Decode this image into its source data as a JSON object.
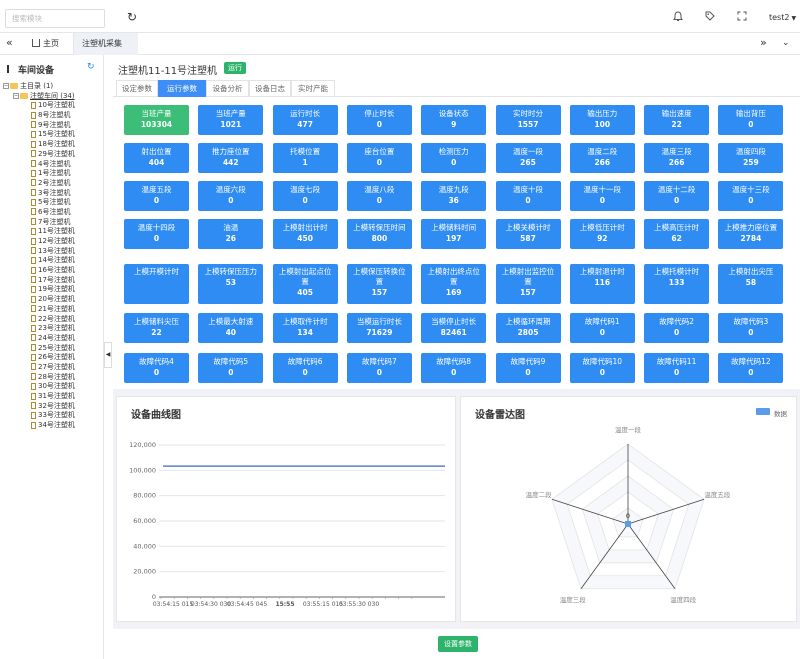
{
  "topbar": {
    "search_placeholder": "搜索模块",
    "user_name": "test2"
  },
  "tabs": {
    "home_label": "主页",
    "active_label": "注塑机采集"
  },
  "left_panel": {
    "title": "车间设备",
    "tree_root": "主目录 (1)",
    "tree_group": "注塑车间 (34)",
    "machines": [
      "10号注塑机",
      "8号注塑机",
      "9号注塑机",
      "15号注塑机",
      "18号注塑机",
      "29号注塑机",
      "4号注塑机",
      "1号注塑机",
      "2号注塑机",
      "3号注塑机",
      "5号注塑机",
      "6号注塑机",
      "7号注塑机",
      "11号注塑机",
      "12号注塑机",
      "13号注塑机",
      "14号注塑机",
      "16号注塑机",
      "17号注塑机",
      "19号注塑机",
      "20号注塑机",
      "21号注塑机",
      "22号注塑机",
      "23号注塑机",
      "24号注塑机",
      "25号注塑机",
      "26号注塑机",
      "27号注塑机",
      "28号注塑机",
      "30号注塑机",
      "31号注塑机",
      "32号注塑机",
      "33号注塑机",
      "34号注塑机"
    ]
  },
  "main": {
    "machine_title": "注塑机11-11号注塑机",
    "status": "运行",
    "subtabs": [
      "设定参数",
      "运行参数",
      "设备分析",
      "设备日志",
      "实时产能"
    ],
    "active_subtab": 1,
    "cards": [
      [
        {
          "label": "当班产量",
          "value": "103304",
          "highlight": true
        },
        {
          "label": "当班产量",
          "value": "1021"
        },
        {
          "label": "运行时长",
          "value": "477"
        },
        {
          "label": "停止时长",
          "value": "0"
        },
        {
          "label": "设备状态",
          "value": "9"
        },
        {
          "label": "实时时分",
          "value": "1557"
        },
        {
          "label": "输出压力",
          "value": "100"
        },
        {
          "label": "输出速度",
          "value": "22"
        },
        {
          "label": "输出背压",
          "value": "0"
        }
      ],
      [
        {
          "label": "射出位置",
          "value": "404"
        },
        {
          "label": "推力座位置",
          "value": "442"
        },
        {
          "label": "托模位置",
          "value": "1"
        },
        {
          "label": "座台位置",
          "value": "0"
        },
        {
          "label": "检测压力",
          "value": "0"
        },
        {
          "label": "温度一段",
          "value": "265"
        },
        {
          "label": "温度二段",
          "value": "266"
        },
        {
          "label": "温度三段",
          "value": "266"
        },
        {
          "label": "温度四段",
          "value": "259"
        }
      ],
      [
        {
          "label": "温度五段",
          "value": "0"
        },
        {
          "label": "温度六段",
          "value": "0"
        },
        {
          "label": "温度七段",
          "value": "0"
        },
        {
          "label": "温度八段",
          "value": "0"
        },
        {
          "label": "温度九段",
          "value": "36"
        },
        {
          "label": "温度十段",
          "value": "0"
        },
        {
          "label": "温度十一段",
          "value": "0"
        },
        {
          "label": "温度十二段",
          "value": "0"
        },
        {
          "label": "温度十三段",
          "value": "0"
        }
      ],
      [
        {
          "label": "温度十四段",
          "value": "0"
        },
        {
          "label": "油温",
          "value": "26"
        },
        {
          "label": "上模射出计时",
          "value": "450"
        },
        {
          "label": "上模转保压时间",
          "value": "800"
        },
        {
          "label": "上模储料时间",
          "value": "197"
        },
        {
          "label": "上模关模计时",
          "value": "587"
        },
        {
          "label": "上模低压计时",
          "value": "92"
        },
        {
          "label": "上模高压计时",
          "value": "62"
        },
        {
          "label": "上模推力座位置",
          "value": "2784"
        }
      ],
      [
        {
          "label": "上模开模计时",
          "value": ""
        },
        {
          "label": "上模转保压压力",
          "value": "53"
        },
        {
          "label": "上模射出起点位置",
          "value": "405"
        },
        {
          "label": "上模保压转换位置",
          "value": "157"
        },
        {
          "label": "上模射出终点位置",
          "value": "169"
        },
        {
          "label": "上模射出监控位置",
          "value": "157"
        },
        {
          "label": "上模射退计时",
          "value": "116"
        },
        {
          "label": "上模托模计时",
          "value": "133"
        },
        {
          "label": "上模射出尖压",
          "value": "58"
        }
      ],
      [
        {
          "label": "上模储料尖压",
          "value": "22"
        },
        {
          "label": "上模最大射速",
          "value": "40"
        },
        {
          "label": "上模取件计时",
          "value": "134"
        },
        {
          "label": "当模运行时长",
          "value": "71629"
        },
        {
          "label": "当模停止时长",
          "value": "82461"
        },
        {
          "label": "上模循环周期",
          "value": "2805"
        },
        {
          "label": "故障代码1",
          "value": "0"
        },
        {
          "label": "故障代码2",
          "value": "0"
        },
        {
          "label": "故障代码3",
          "value": "0"
        }
      ],
      [
        {
          "label": "故障代码4",
          "value": "0"
        },
        {
          "label": "故障代码5",
          "value": "0"
        },
        {
          "label": "故障代码6",
          "value": "0"
        },
        {
          "label": "故障代码7",
          "value": "0"
        },
        {
          "label": "故障代码8",
          "value": "0"
        },
        {
          "label": "故障代码9",
          "value": "0"
        },
        {
          "label": "故障代码10",
          "value": "0"
        },
        {
          "label": "故障代码11",
          "value": "0"
        },
        {
          "label": "故障代码12",
          "value": "0"
        }
      ]
    ],
    "save_label": "设置参数"
  },
  "chart_data": [
    {
      "type": "line",
      "title": "设备曲线图",
      "x": [
        "03:54:15 015",
        "03:54:30 030",
        "03:54:45 045",
        "15:55",
        "03:55:15 015",
        "03:55:30 030"
      ],
      "bold_ticks": [
        "15:55"
      ],
      "series": [
        {
          "values": [
            103304,
            103304,
            103304,
            103304,
            103304,
            103304
          ]
        }
      ],
      "ylim": [
        0,
        120000
      ],
      "yticks": [
        "0",
        "20,000",
        "40,000",
        "60,000",
        "80,000",
        "100,000",
        "120,000"
      ],
      "line_color": "#3a66c4"
    },
    {
      "type": "radar",
      "title": "设备雷达图",
      "legend": "数据",
      "indicators": [
        "温度一段",
        "温度五段",
        "温度四段",
        "温度三段",
        "温度二段"
      ],
      "values": [
        0,
        0,
        0,
        0,
        0
      ],
      "value_label": "0",
      "color": "#5b9bec"
    }
  ]
}
